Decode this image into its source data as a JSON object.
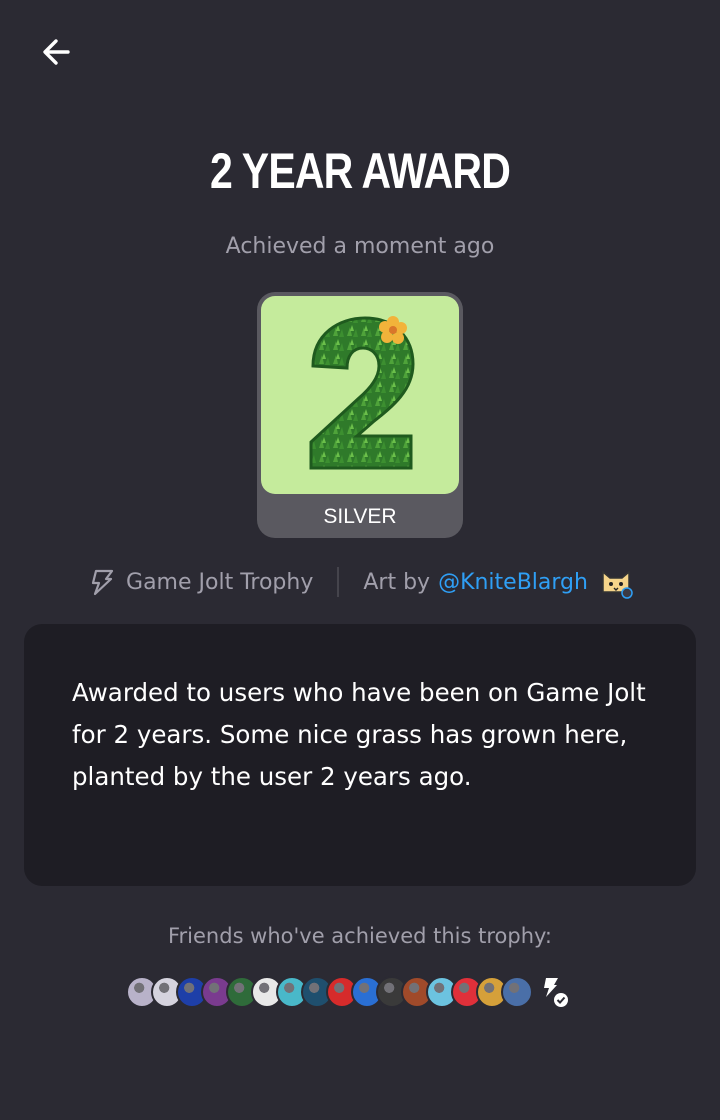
{
  "header": {
    "back_icon": "arrow-left-icon",
    "title": "2 YEAR AWARD",
    "achieved": "Achieved a moment ago"
  },
  "trophy": {
    "tier": "SILVER",
    "image": "grass-number-2-image",
    "background_color": "#c5eb9c",
    "frame_color": "#5a5960"
  },
  "meta": {
    "source_icon": "game-jolt-bolt-icon",
    "source_label": "Game Jolt Trophy",
    "art_prefix": "Art by",
    "artist": "@KniteBlargh",
    "artist_avatar": "cat-avatar-icon",
    "link_color": "#2f9ff5"
  },
  "description": {
    "text": "Awarded to users who have been on Game Jolt for 2 years. Some nice grass has grown here, planted by the user 2 years ago."
  },
  "friends": {
    "label": "Friends who've achieved this trophy:",
    "avatars": [
      "#b8b2c9",
      "#d5d3de",
      "#1e3fa8",
      "#7a3b8f",
      "#2f6b3a",
      "#e8e8e8",
      "#49b8c9",
      "#1f4f6e",
      "#d62b2b",
      "#2a6fd4",
      "#3a3a3a",
      "#a04a2a",
      "#6cc3e0",
      "#e0303a",
      "#d5a03a",
      "#4a6fa8"
    ],
    "more_icon": "game-jolt-verified-icon"
  },
  "colors": {
    "background": "#2b2a33",
    "card": "#1e1d24",
    "muted_text": "#a19fab"
  }
}
